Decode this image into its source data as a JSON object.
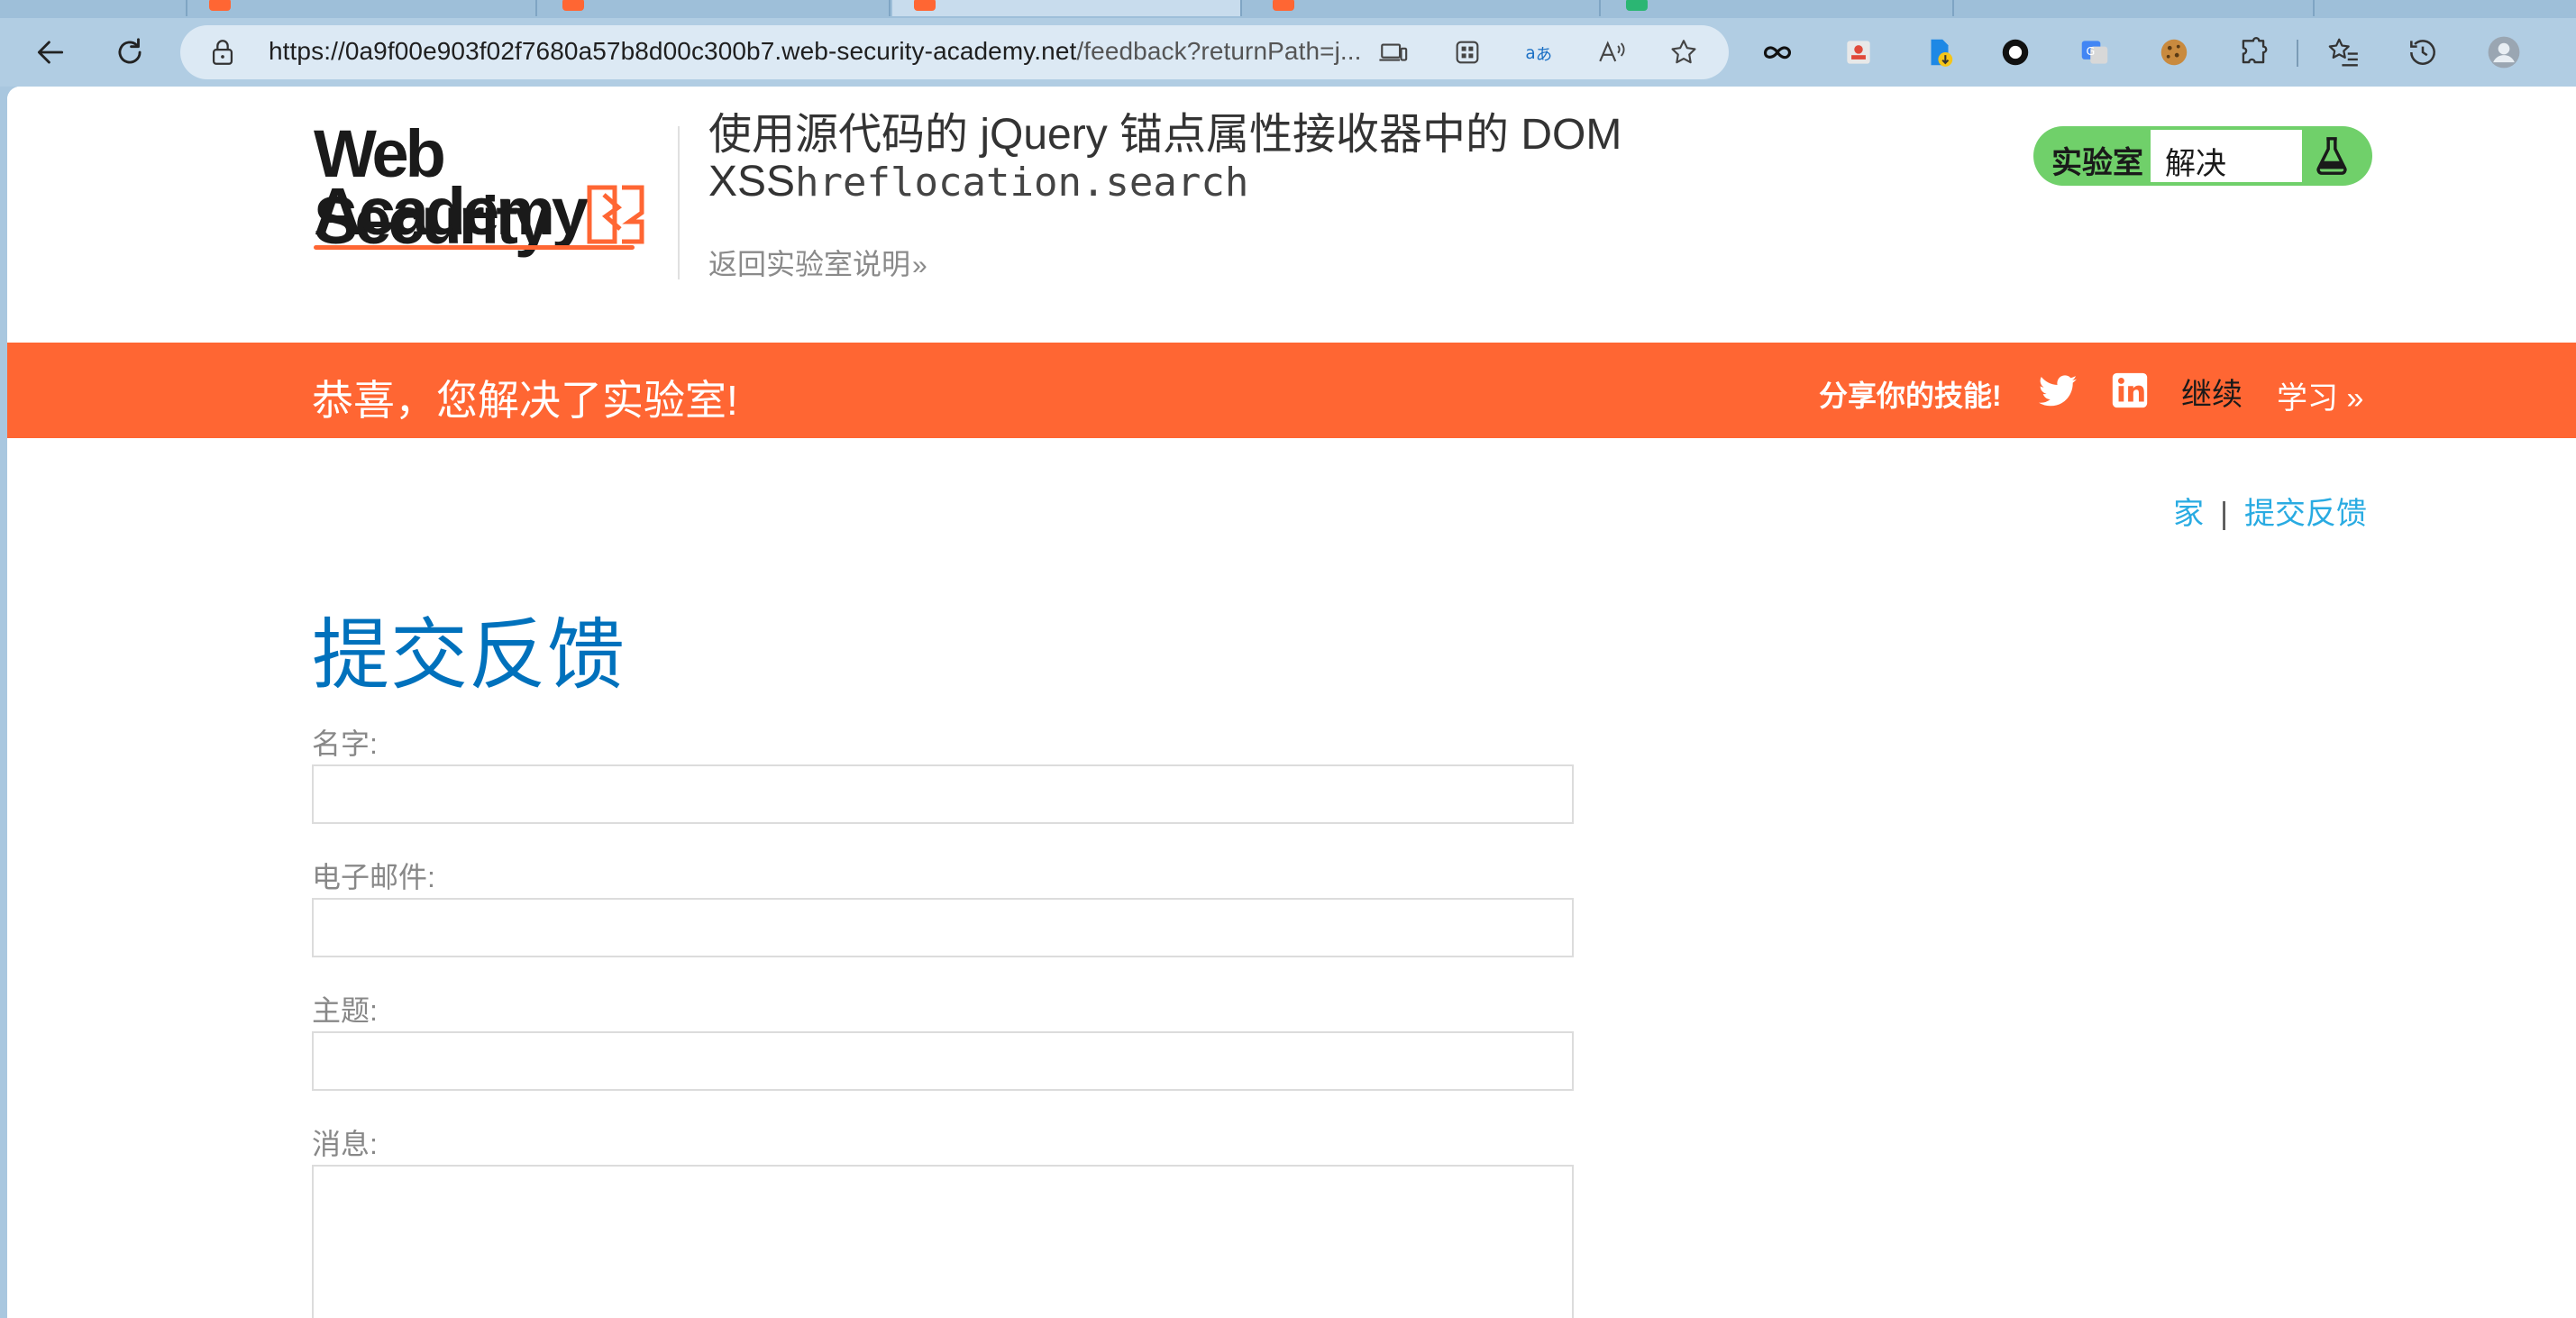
{
  "browser": {
    "url_host": "https://0a9f00e903f02f7680a57b8d00c300b7.web-security-academy.net",
    "url_rest": "/feedback?returnPath=j..."
  },
  "lab": {
    "logo_line1": "Web Security",
    "logo_line2": "Academy",
    "title_line1": "使用源代码的 jQuery 锚点属性接收器中的 DOM",
    "title_xss": "XSS",
    "title_code": "hreflocation.search",
    "back_link": "返回实验室说明",
    "status_label": "实验室",
    "status_value": "解决"
  },
  "banner": {
    "message": "恭喜，您解决了实验室!",
    "share": "分享你的技能!",
    "continue": "继续",
    "learn": "学习"
  },
  "breadcrumbs": {
    "home": "家",
    "separator": "|",
    "current": "提交反馈"
  },
  "page": {
    "title": "提交反馈"
  },
  "form": {
    "name_label": "名字:",
    "name_value": "",
    "email_label": "电子邮件:",
    "email_value": "",
    "subject_label": "主题:",
    "subject_value": "",
    "message_label": "消息:",
    "message_value": ""
  },
  "colors": {
    "brand_orange": "#ff6633",
    "link_blue": "#29abe2",
    "title_blue": "#0071bc",
    "solved_green": "#70d06a"
  }
}
